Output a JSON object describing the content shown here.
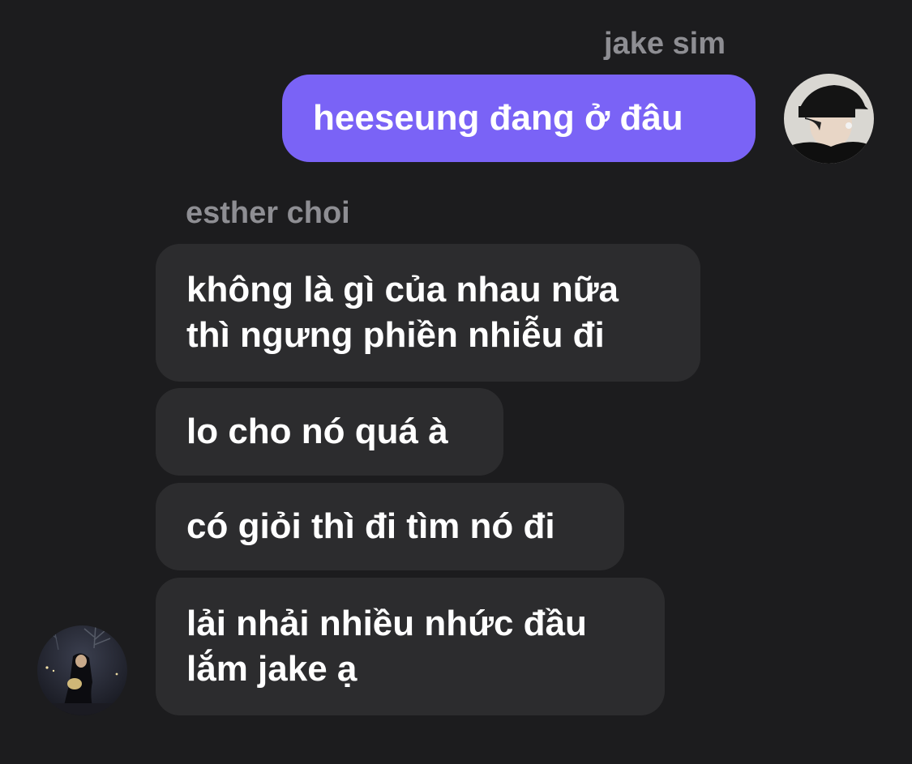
{
  "conversation": {
    "outgoing_sender": "jake sim",
    "outgoing_message": "heeseung đang ở đâu",
    "incoming_sender": "esther choi",
    "incoming_messages": [
      {
        "lines": [
          "không là gì của nhau nữa",
          "thì ngưng phiền nhiễu đi"
        ]
      },
      {
        "lines": [
          "lo cho nó quá à"
        ]
      },
      {
        "lines": [
          "có giỏi thì đi tìm nó đi"
        ]
      },
      {
        "lines": [
          "lải nhải nhiều nhức đầu",
          "lắm jake ạ"
        ]
      }
    ]
  },
  "avatars": {
    "outgoing": "jake-sim-avatar-photo",
    "incoming": "esther-choi-avatar-photo"
  },
  "colors": {
    "background": "#1c1c1e",
    "outgoing_bubble": "#7a63f6",
    "incoming_bubble": "#2c2c2e",
    "sender_name": "#8e8e93",
    "message_text": "#ffffff"
  }
}
